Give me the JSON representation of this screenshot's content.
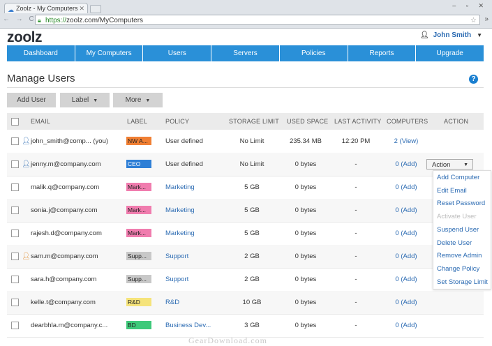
{
  "browser": {
    "tab_title": "Zoolz - My Computers",
    "url_scheme": "https://",
    "url_rest": "zoolz.com/MyComputers",
    "nav_glyphs": "← → C",
    "window_controls": "– ▫ ✕"
  },
  "app": {
    "logo": "zoolz",
    "user_name": "John Smith"
  },
  "nav": [
    "Dashboard",
    "My Computers",
    "Users",
    "Servers",
    "Policies",
    "Reports",
    "Upgrade"
  ],
  "page": {
    "title": "Manage Users",
    "help": "?"
  },
  "toolbar": {
    "add_user": "Add User",
    "label": "Label",
    "more": "More"
  },
  "table": {
    "headers": {
      "email": "EMAIL",
      "label": "LABEL",
      "policy": "POLICY",
      "storage_limit": "STORAGE LIMIT",
      "used_space": "USED SPACE",
      "last_activity": "LAST ACTIVITY",
      "computers": "COMPUTERS",
      "action": "ACTION"
    },
    "rows": [
      {
        "email": "john_smith@comp... (you)",
        "label": "NW A...",
        "label_color": "#f07f33",
        "policy": "User defined",
        "storage_limit": "No Limit",
        "used_space": "235.34 MB",
        "last_activity": "12:20 PM",
        "computers": "2 (View)"
      },
      {
        "email": "jenny.m@company.com",
        "label": "CEO",
        "label_color": "#2e7fd6",
        "policy": "User defined",
        "storage_limit": "No Limit",
        "used_space": "0 bytes",
        "last_activity": "-",
        "computers": "0 (Add)"
      },
      {
        "email": "malik.q@company.com",
        "label": "Mark...",
        "label_color": "#f07cae",
        "policy": "Marketing",
        "storage_limit": "5 GB",
        "used_space": "0 bytes",
        "last_activity": "-",
        "computers": "0 (Add)"
      },
      {
        "email": "sonia.j@company.com",
        "label": "Mark...",
        "label_color": "#f07cae",
        "policy": "Marketing",
        "storage_limit": "5 GB",
        "used_space": "0 bytes",
        "last_activity": "-",
        "computers": "0 (Add)"
      },
      {
        "email": "rajesh.d@company.com",
        "label": "Mark...",
        "label_color": "#f07cae",
        "policy": "Marketing",
        "storage_limit": "5 GB",
        "used_space": "0 bytes",
        "last_activity": "-",
        "computers": "0 (Add)"
      },
      {
        "email": "sam.m@company.com",
        "label": "Supp...",
        "label_color": "#c8c8c8",
        "policy": "Support",
        "storage_limit": "2 GB",
        "used_space": "0 bytes",
        "last_activity": "-",
        "computers": "0 (Add)"
      },
      {
        "email": "sara.h@company.com",
        "label": "Supp...",
        "label_color": "#c8c8c8",
        "policy": "Support",
        "storage_limit": "2 GB",
        "used_space": "0 bytes",
        "last_activity": "-",
        "computers": "0 (Add)"
      },
      {
        "email": "kelle.t@company.com",
        "label": "R&D",
        "label_color": "#f5e37a",
        "policy": "R&D",
        "storage_limit": "10 GB",
        "used_space": "0 bytes",
        "last_activity": "-",
        "computers": "0 (Add)"
      },
      {
        "email": "dearbhla.m@company.c...",
        "label": "BD",
        "label_color": "#3ec97a",
        "policy": "Business Dev...",
        "storage_limit": "3 GB",
        "used_space": "0 bytes",
        "last_activity": "-",
        "computers": "0 (Add)"
      }
    ]
  },
  "action_dropdown": {
    "button_label": "Action",
    "items": [
      {
        "label": "Add Computer",
        "enabled": true
      },
      {
        "label": "Edit Email",
        "enabled": true
      },
      {
        "label": "Reset Password",
        "enabled": true
      },
      {
        "label": "Activate User",
        "enabled": false
      },
      {
        "label": "Suspend User",
        "enabled": true
      },
      {
        "label": "Delete User",
        "enabled": true
      },
      {
        "label": "Remove Admin",
        "enabled": true
      },
      {
        "label": "Change Policy",
        "enabled": true
      },
      {
        "label": "Set Storage Limit",
        "enabled": true
      }
    ]
  },
  "watermark": "GearDownload.com"
}
